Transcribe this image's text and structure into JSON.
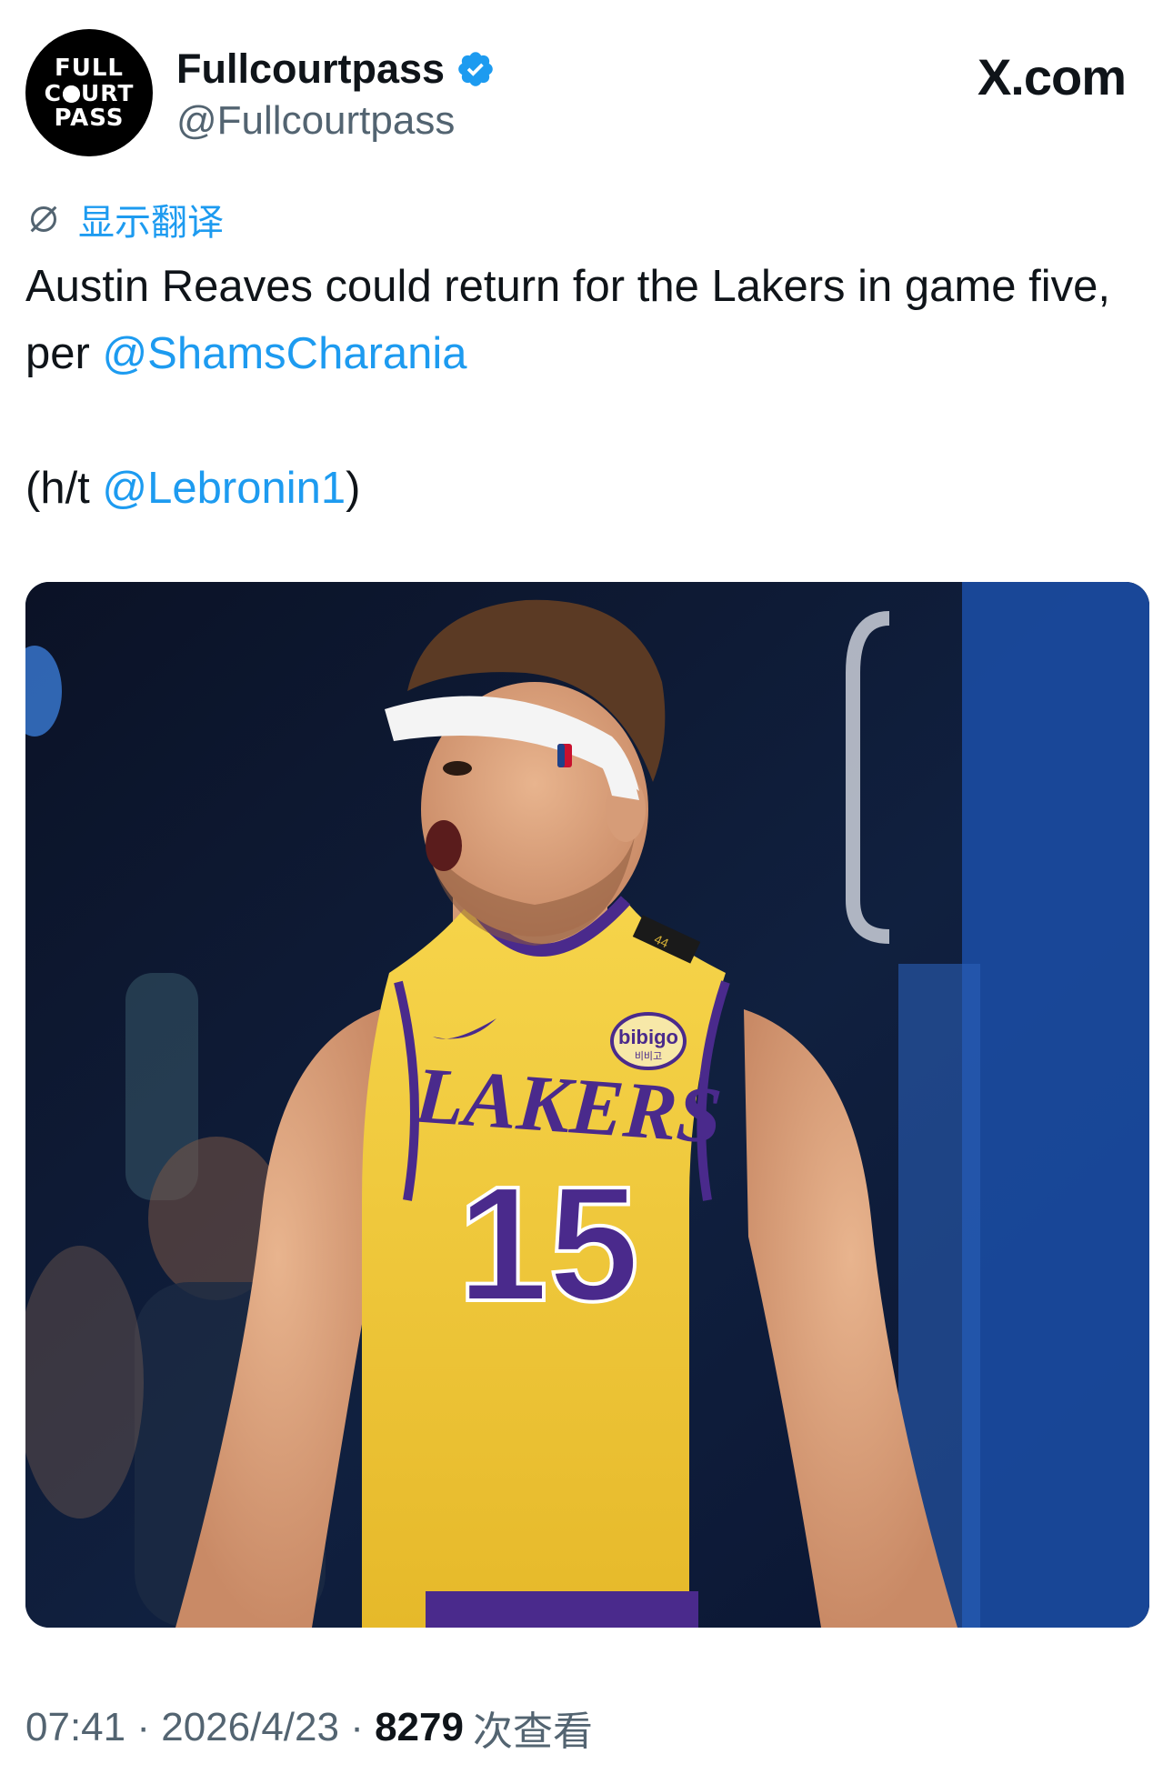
{
  "header": {
    "avatar_lines": [
      "FULL",
      "C",
      "URT",
      "PASS"
    ],
    "display_name": "Fullcourtpass",
    "handle": "@Fullcourtpass",
    "site_logo": "X.com",
    "verified_color": "#1d9bf0"
  },
  "translate": {
    "icon": "globe-slash-icon",
    "label": "显示翻译"
  },
  "tweet": {
    "text_part1": "Austin Reaves could return for the Lakers in game five, per ",
    "mention1": "@ShamsCharania",
    "text_part2": "(h/t ",
    "mention2": "@Lebronin1",
    "text_part3": ")"
  },
  "photo": {
    "jersey_team": "LAKERS",
    "jersey_number": "15",
    "sponsor": "bibigo",
    "sponsor_sub": "비비고",
    "band_number": "44"
  },
  "meta": {
    "time": "07:41",
    "separator": " · ",
    "date": "2026/4/23",
    "views_count": "8279",
    "views_label": "次查看"
  },
  "colors": {
    "accent": "#1d9bf0",
    "text": "#0f1419",
    "secondary": "#536471",
    "jersey_yellow": "#f2c82e",
    "jersey_purple": "#4a2a8c"
  }
}
